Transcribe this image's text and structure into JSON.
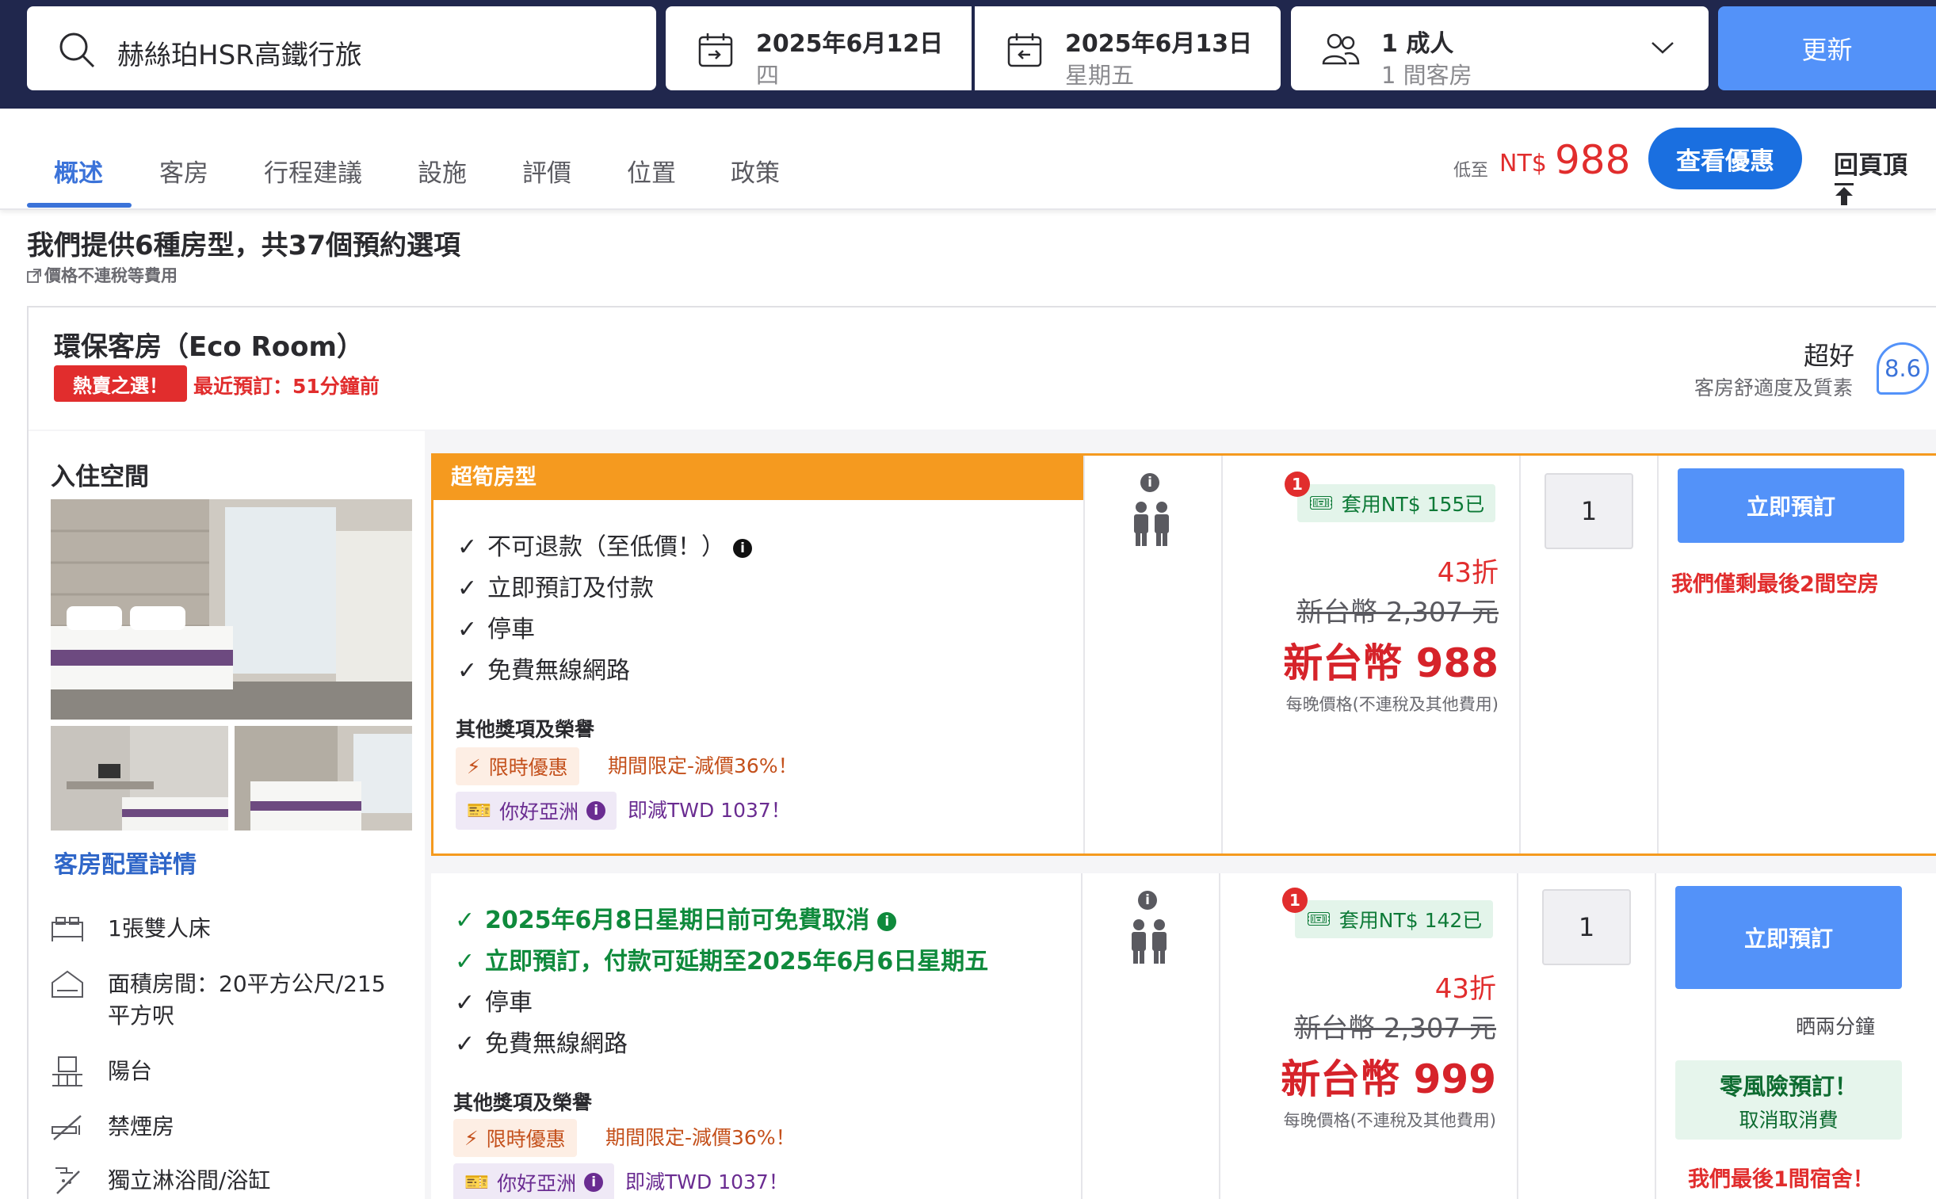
{
  "search": {
    "destination": "赫絲珀HSR高鐵行旅",
    "checkin": {
      "date": "2025年6月12日",
      "weekday": "四"
    },
    "checkout": {
      "date": "2025年6月13日",
      "weekday": "星期五"
    },
    "occupancy": {
      "adults": "1 成人",
      "rooms": "1 間客房"
    },
    "update_label": "更新"
  },
  "nav": {
    "tabs": [
      "概述",
      "客房",
      "行程建議",
      "設施",
      "評價",
      "位置",
      "政策"
    ],
    "lowest_label": "低至",
    "lowest_currency": "NT$",
    "lowest_price": "988",
    "deal_label": "查看優惠",
    "back_top_label": "回頁頂"
  },
  "summary": {
    "title": "我們提供6種房型，共37個預約選項",
    "note": "價格不連稅等費用"
  },
  "room": {
    "name": "環保客房（Eco Room）",
    "hot_badge": "熱賣之選！",
    "recent": "最近預訂：51分鐘前",
    "rating_word": "超好",
    "rating_sub": "客房舒適度及質素",
    "score": "8.6",
    "occupancy_label": "入住空間",
    "config_link": "客房配置詳情",
    "features": [
      "1張雙人床",
      "面積房間：20平方公尺/215",
      "平方呎",
      "陽台",
      "禁煙房",
      "獨立淋浴間/浴缸"
    ]
  },
  "offers": [
    {
      "header": "超筍房型",
      "benefits": [
        "不可退款（至低價！）",
        "立即預訂及付款",
        "停車",
        "免費無線網路"
      ],
      "other_title": "其他獎項及榮譽",
      "promo_limited": {
        "label": "限時優惠",
        "desc": "期間限定-減價36%！"
      },
      "promo_asia": {
        "label": "你好亞洲",
        "desc": "即減TWD 1037！"
      },
      "coupon_count": "1",
      "coupon": "套用NT$ 155已",
      "discount": "43折",
      "original_price": "新台幣 2,307 元",
      "price": "新台幣 988",
      "per_night": "每晚價格(不連稅及其他費用)",
      "quantity": "1",
      "book_label": "立即預訂",
      "rooms_left": "我們僅剩最後2間空房"
    },
    {
      "benefits_green": [
        "2025年6月8日星期日前可免費取消",
        "立即預訂，付款可延期至2025年6月6日星期五"
      ],
      "benefits": [
        "停車",
        "免費無線網路"
      ],
      "other_title": "其他獎項及榮譽",
      "promo_limited": {
        "label": "限時優惠",
        "desc": "期間限定-減價36%！"
      },
      "promo_asia": {
        "label": "你好亞洲",
        "desc": "即減TWD 1037！"
      },
      "coupon_count": "1",
      "coupon": "套用NT$ 142已",
      "discount": "43折",
      "original_price": "新台幣 2,307 元",
      "price": "新台幣 999",
      "per_night": "每晚價格(不連稅及其他費用)",
      "quantity": "1",
      "book_label": "立即預訂",
      "booking_time": "晒兩分鐘",
      "zero_risk_title": "零風險預訂！",
      "zero_risk_sub": "取消取消費",
      "rooms_left": "我們最後1間宿舍！"
    }
  ]
}
